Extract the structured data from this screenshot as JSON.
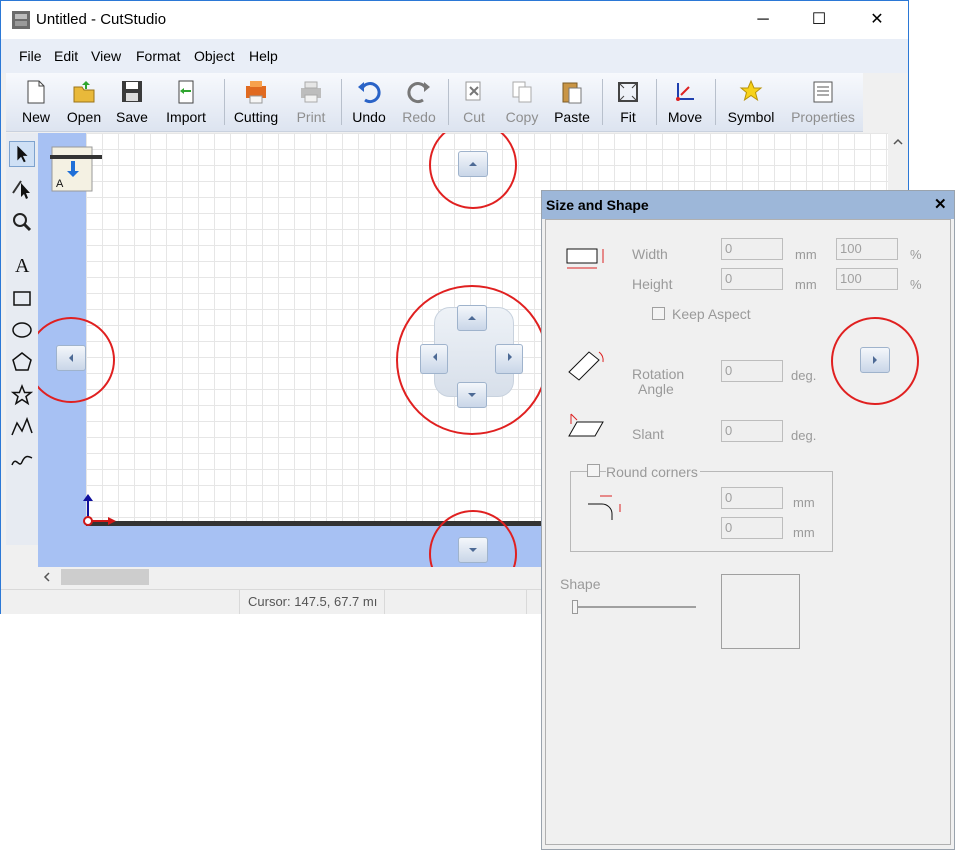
{
  "window": {
    "title": "Untitled - CutStudio",
    "minimize": "─",
    "maximize": "☐",
    "close": "✕"
  },
  "menu": [
    "File",
    "Edit",
    "View",
    "Format",
    "Object",
    "Help"
  ],
  "toolbar": {
    "new": "New",
    "open": "Open",
    "save": "Save",
    "import": "Import",
    "cutting": "Cutting",
    "print": "Print",
    "undo": "Undo",
    "redo": "Redo",
    "cut": "Cut",
    "copy": "Copy",
    "paste": "Paste",
    "fit": "Fit",
    "move": "Move",
    "symbol": "Symbol",
    "properties": "Properties"
  },
  "status": {
    "cursor": "Cursor: 147.5, 67.7 mı"
  },
  "dialog": {
    "title": "Size and Shape",
    "close": "✕",
    "width_label": "Width",
    "height_label": "Height",
    "width_value": "0",
    "height_value": "0",
    "width_pct": "100",
    "height_pct": "100",
    "mm": "mm",
    "pct": "%",
    "keep_aspect": "Keep Aspect",
    "rotation_label_1": "Rotation",
    "rotation_label_2": "Angle",
    "rotation_value": "0",
    "deg": "deg.",
    "slant_label": "Slant",
    "slant_value": "0",
    "round_corners": "Round corners",
    "round_value_1": "0",
    "round_value_2": "0",
    "shape_label": "Shape"
  },
  "colors": {
    "accent": "#2b78d6",
    "media_blue": "#a7c1f3",
    "highlight_red": "#e02020"
  }
}
